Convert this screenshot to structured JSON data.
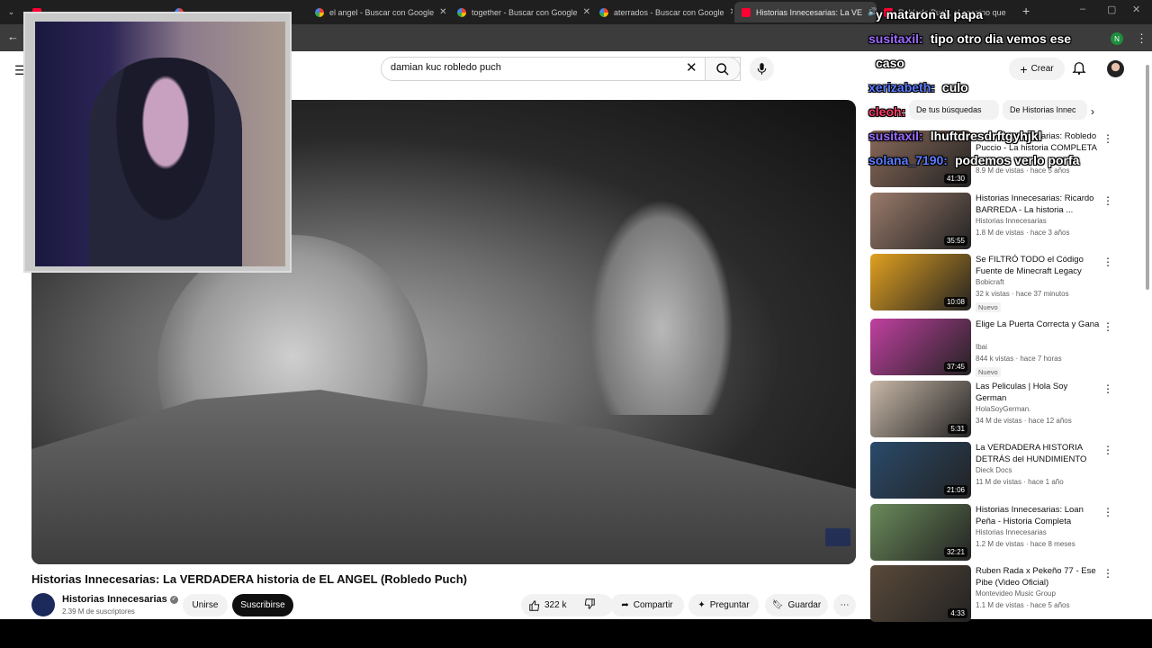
{
  "browser": {
    "tabs": [
      {
        "label": "",
        "icon": "youtube"
      },
      {
        "label": "",
        "icon": "google"
      },
      {
        "label": "el angel - Buscar con Google",
        "icon": "google"
      },
      {
        "label": "together - Buscar con Google",
        "icon": "google"
      },
      {
        "label": "aterrados - Buscar con Google",
        "icon": "google"
      },
      {
        "label": "Historias Innecesarias: La VE",
        "icon": "youtube"
      },
      {
        "label": "Robledo Puch, el asesino que",
        "icon": "youtube"
      }
    ],
    "profile_initial": "N"
  },
  "youtube": {
    "search_query": "damian kuc robledo puch",
    "create_label": "Crear",
    "video": {
      "title": "Historias Innecesarias: La VERDADERA historia de EL ANGEL (Robledo Puch)",
      "channel": "Historias Innecesarias",
      "subscribers": "2.39 M de suscriptores",
      "join_label": "Unirse",
      "subscribe_label": "Suscribirse",
      "likes": "322 k",
      "share_label": "Compartir",
      "ask_label": "Preguntar",
      "save_label": "Guardar"
    },
    "chips": [
      "De tus búsquedas",
      "De Historias Innec"
    ],
    "recommendations": [
      {
        "title": "Historias Innecesarias: Robledo Puccio - La historia COMPLETA",
        "channel": "",
        "meta": "8.9 M de vistas · hace 5 años",
        "duration": "41:30",
        "badge": "",
        "thumb_color": "#8a6a5a"
      },
      {
        "title": "Historias Innecesarias: Ricardo BARREDA - La historia ...",
        "channel": "Historias Innecesarias",
        "meta": "1.8 M de vistas · hace 3 años",
        "duration": "35:55",
        "badge": "",
        "thumb_color": "#9a7a6a"
      },
      {
        "title": "Se FILTRÓ TODO el Código Fuente de Minecraft Legacy",
        "channel": "Bobicraft",
        "meta": "32 k vistas · hace 37 minutos",
        "duration": "10:08",
        "badge": "Nuevo",
        "thumb_color": "#e0a020"
      },
      {
        "title": "Elige La Puerta Correcta y Gana",
        "channel": "Ibai",
        "meta": "844 k vistas · hace 7 horas",
        "duration": "37:45",
        "badge": "Nuevo",
        "thumb_color": "#c040a0"
      },
      {
        "title": "Las Peliculas | Hola Soy German",
        "channel": "HolaSoyGerman.",
        "meta": "34 M de vistas · hace 12 años",
        "duration": "5:31",
        "badge": "",
        "thumb_color": "#c8b8a8"
      },
      {
        "title": "La VERDADERA HISTORIA DETRÁS del HUNDIMIENTO de...",
        "channel": "Dieck Docs",
        "meta": "11 M de vistas · hace 1 año",
        "duration": "21:06",
        "badge": "",
        "thumb_color": "#2a4a6a"
      },
      {
        "title": "Historias Innecesarias: Loan Peña - Historia Completa",
        "channel": "Historias Innecesarias",
        "meta": "1.2 M de vistas · hace 8 meses",
        "duration": "32:21",
        "badge": "",
        "thumb_color": "#6a8a5a"
      },
      {
        "title": "Ruben Rada x Pekeño 77 - Ese Pibe (Video Oficial)",
        "channel": "Montevideo Music Group",
        "meta": "1.1 M de vistas · hace 5 años",
        "duration": "4:33",
        "badge": "",
        "thumb_color": "#5a4a3a"
      }
    ]
  },
  "chat": [
    {
      "user": "",
      "user_color": "#8a7cff",
      "message": "y mataron al papa"
    },
    {
      "user": "susitaxil:",
      "user_color": "#9b6bff",
      "message": "tipo otro dia vemos ese"
    },
    {
      "user": "",
      "user_color": "#9b6bff",
      "message": "caso"
    },
    {
      "user": "xerizabeth:",
      "user_color": "#5b7cff",
      "message": "culo"
    },
    {
      "user": "cleoh:",
      "user_color": "#ff3b6b",
      "message": ""
    },
    {
      "user": "susitaxil:",
      "user_color": "#9b6bff",
      "message": "lhuftdresdrftgyhjkl"
    },
    {
      "user": "solana_7190:",
      "user_color": "#5b7cff",
      "message": "podemos verlo porfa"
    }
  ]
}
